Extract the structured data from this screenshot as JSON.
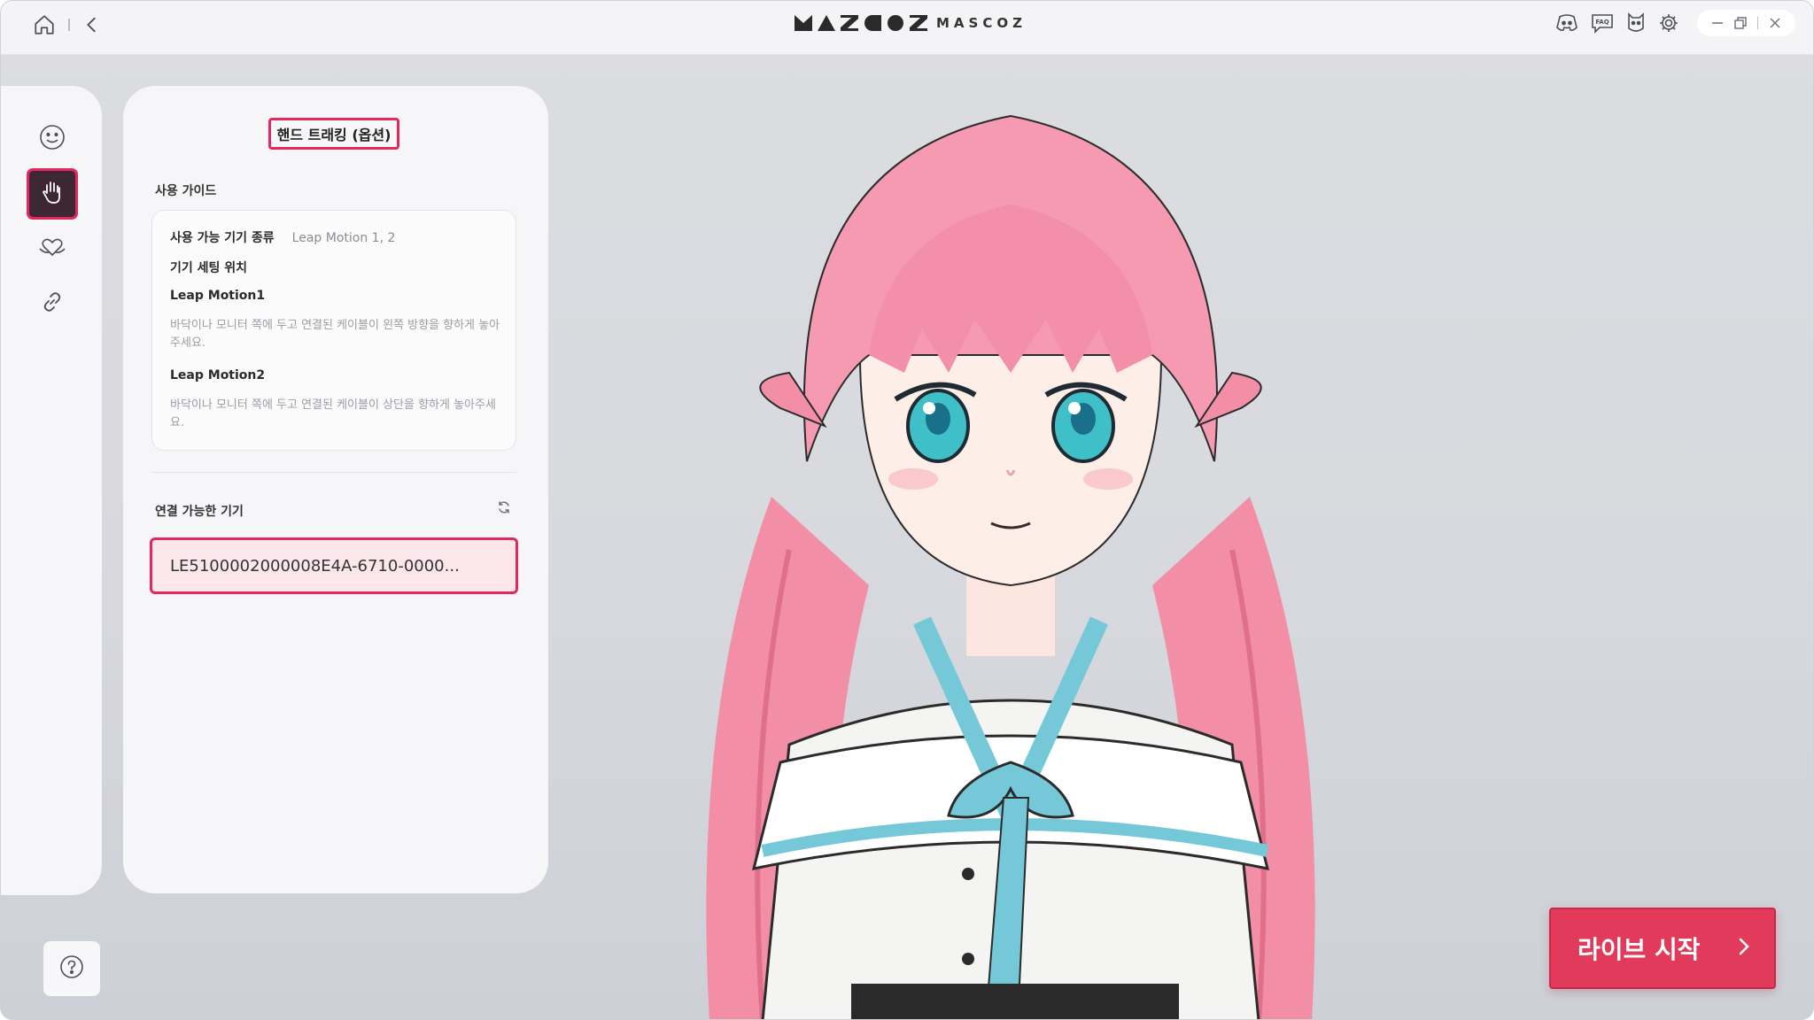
{
  "app": {
    "logo_text": "MASCOZ",
    "brand_color": "#e2285d",
    "button_color": "#e23a5a"
  },
  "titlebar": {
    "left_icons": [
      "home-icon",
      "back-icon"
    ],
    "right_icons": [
      "discord-icon",
      "faq-icon",
      "character-icon",
      "gear-icon"
    ],
    "window_controls": [
      "minimize-icon",
      "restore-icon",
      "close-icon"
    ]
  },
  "sidebar": {
    "items": [
      {
        "icon": "face-icon",
        "active": false
      },
      {
        "icon": "hand-icon",
        "active": true
      },
      {
        "icon": "heart-hands-icon",
        "active": false
      },
      {
        "icon": "link-icon",
        "active": false
      }
    ],
    "help_icon": "help-icon"
  },
  "panel": {
    "title": "핸드 트래킹 (옵션)",
    "guide_label": "사용 가이드",
    "guide": {
      "device_type_label": "사용 가능 기기 종류",
      "device_type_value": "Leap Motion 1, 2",
      "setup_label": "기기 세팅 위치",
      "lm1_title": "Leap Motion1",
      "lm1_desc": "바닥이나 모니터 쪽에 두고 연결된 케이블이 왼쪽 방향을 향하게 놓아주세요.",
      "lm2_title": "Leap Motion2",
      "lm2_desc": "바닥이나 모니터 쪽에 두고 연결된 케이블이 상단을 향하게 놓아주세요."
    },
    "devices_label": "연결 가능한 기기",
    "devices": [
      "LE5100002000008E4A-6710-0000..."
    ]
  },
  "live_button": {
    "label": "라이브 시작"
  }
}
